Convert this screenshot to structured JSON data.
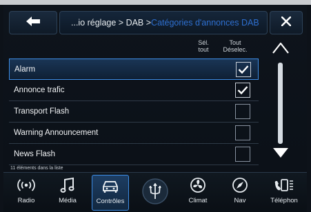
{
  "header": {
    "breadcrumb_main": "...io réglage > DAB > ",
    "breadcrumb_current": "Catégories d'annonces DAB"
  },
  "columns": {
    "select_all": "Sél. tout",
    "deselect_all": "Tout Déselec."
  },
  "list": {
    "items": [
      {
        "label": "Alarm",
        "checked": true
      },
      {
        "label": "Annonce trafic",
        "checked": true
      },
      {
        "label": "Transport Flash",
        "checked": false
      },
      {
        "label": "Warning Announcement",
        "checked": false
      },
      {
        "label": "News Flash",
        "checked": false
      }
    ],
    "count_text": "11 éléments dans la liste"
  },
  "nav": {
    "items": [
      {
        "label": "Radio",
        "icon": "radio-icon"
      },
      {
        "label": "Média",
        "icon": "music-note-icon"
      },
      {
        "label": "Contrôles",
        "icon": "car-icon",
        "active": true
      },
      {
        "label": "",
        "icon": "trident-logo-icon"
      },
      {
        "label": "Climat",
        "icon": "climate-fan-icon"
      },
      {
        "label": "Nav",
        "icon": "compass-icon"
      },
      {
        "label": "Téléphon",
        "icon": "phone-icon"
      }
    ]
  },
  "colors": {
    "accent": "#3d8de6",
    "breadcrumb_current": "#2e6fd0",
    "background": "#0d1219"
  }
}
